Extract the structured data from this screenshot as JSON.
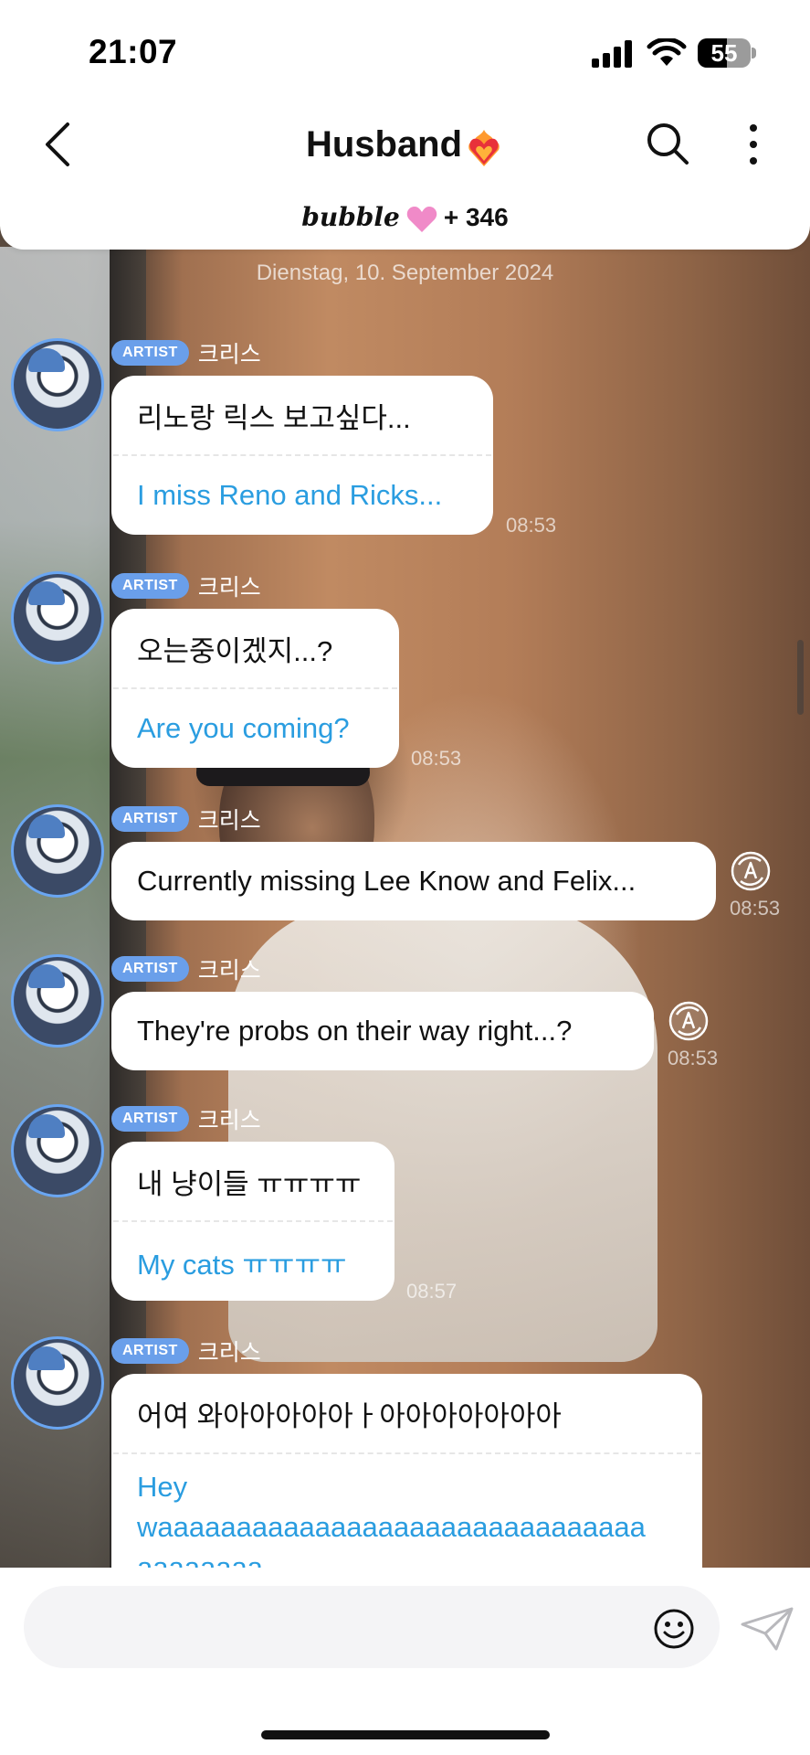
{
  "status_bar": {
    "time": "21:07",
    "battery_level": "55",
    "battery_percent": 55,
    "icons": [
      "signal-icon",
      "wifi-icon",
      "battery-icon"
    ]
  },
  "header": {
    "title": "Husband",
    "title_emoji": "heart-on-fire-icon",
    "brand": "bubble",
    "brand_icon": "pink-heart-icon",
    "subscriber_count": "+ 346",
    "icons": [
      "back-icon",
      "search-icon",
      "more-icon"
    ]
  },
  "chat": {
    "date": "Dienstag, 10. September 2024",
    "messages": [
      {
        "badge": "ARTIST",
        "sender": "크리스",
        "text": "리노랑 릭스 보고싶다...",
        "translation": "I miss Reno and Ricks...",
        "time": "08:53"
      },
      {
        "badge": "ARTIST",
        "sender": "크리스",
        "text": "오는중이겠지...?",
        "translation": "Are you coming?",
        "time": "08:53"
      },
      {
        "badge": "ARTIST",
        "sender": "크리스",
        "text": "Currently missing Lee Know and Felix...",
        "translation": "",
        "time": "08:53",
        "has_translate_button": true
      },
      {
        "badge": "ARTIST",
        "sender": "크리스",
        "text": "They're probs on their way right...?",
        "translation": "",
        "time": "08:53",
        "has_translate_button": true
      },
      {
        "badge": "ARTIST",
        "sender": "크리스",
        "text": "내 냥이들 ㅠㅠㅠㅠ",
        "translation": "My cats ㅠㅠㅠㅠ",
        "time": "08:57"
      },
      {
        "badge": "ARTIST",
        "sender": "크리스",
        "text": "어여 와아아아아아ㅏ아아아아아아아",
        "translation_line1": "Hey",
        "translation_line2": "waaaaaaaaaaaaaaaaaaaaaaaaaaaaaaa",
        "translation_line3": "aaaaaaaa",
        "time": ""
      }
    ]
  },
  "composer": {
    "placeholder": "",
    "icons": [
      "emoji-icon",
      "send-icon"
    ]
  },
  "colors": {
    "accent_blue": "#2a9de0",
    "badge_blue": "#6a9fea",
    "bubble_bg": "#ffffff"
  }
}
